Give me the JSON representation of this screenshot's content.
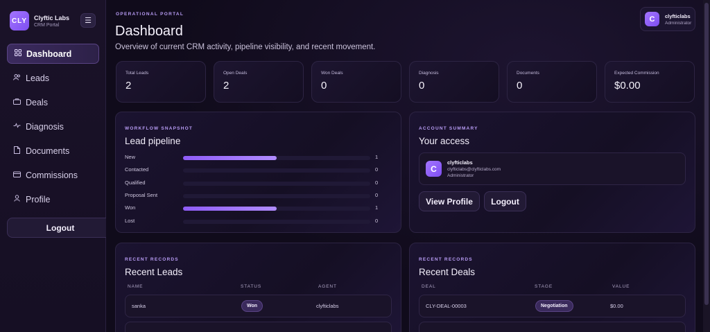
{
  "brand": {
    "logo_text": "CLY",
    "name": "Clyftic Labs",
    "subtitle": "CRM Portal"
  },
  "sidebar": {
    "toggle_icon": "hamburger-icon",
    "items": [
      {
        "label": "Dashboard",
        "icon": "grid-icon",
        "active": true
      },
      {
        "label": "Leads",
        "icon": "users-icon"
      },
      {
        "label": "Deals",
        "icon": "briefcase-icon"
      },
      {
        "label": "Diagnosis",
        "icon": "pulse-icon"
      },
      {
        "label": "Documents",
        "icon": "document-icon"
      },
      {
        "label": "Commissions",
        "icon": "wallet-icon"
      },
      {
        "label": "Profile",
        "icon": "user-icon"
      }
    ],
    "logout_label": "Logout"
  },
  "header": {
    "kicker": "OPERATIONAL PORTAL",
    "title": "Dashboard",
    "subtitle": "Overview of current CRM activity, pipeline visibility, and recent movement."
  },
  "user": {
    "initial": "C",
    "name": "clyfticlabs",
    "role": "Administrator"
  },
  "stats": [
    {
      "label": "Total Leads",
      "value": "2"
    },
    {
      "label": "Open Deals",
      "value": "2"
    },
    {
      "label": "Won Deals",
      "value": "0"
    },
    {
      "label": "Diagnosis",
      "value": "0"
    },
    {
      "label": "Documents",
      "value": "0"
    },
    {
      "label": "Expected Commission",
      "value": "$0.00"
    }
  ],
  "pipeline": {
    "kicker": "WORKFLOW SNAPSHOT",
    "title": "Lead pipeline",
    "stages": [
      {
        "label": "New",
        "count": "1",
        "fill_fraction": 0.5
      },
      {
        "label": "Contacted",
        "count": "0",
        "fill_fraction": 0
      },
      {
        "label": "Qualified",
        "count": "0",
        "fill_fraction": 0
      },
      {
        "label": "Proposal Sent",
        "count": "0",
        "fill_fraction": 0
      },
      {
        "label": "Won",
        "count": "1",
        "fill_fraction": 0.5
      },
      {
        "label": "Lost",
        "count": "0",
        "fill_fraction": 0
      }
    ]
  },
  "account": {
    "kicker": "ACCOUNT SUMMARY",
    "title": "Your access",
    "initial": "C",
    "name": "clyfticlabs",
    "email": "clyfticlabs@clyfticlabs.com",
    "role": "Administrator",
    "view_profile_label": "View Profile",
    "logout_label": "Logout"
  },
  "recent_leads": {
    "kicker": "RECENT RECORDS",
    "title": "Recent Leads",
    "columns": [
      "NAME",
      "STATUS",
      "AGENT"
    ],
    "rows": [
      {
        "name": "sanka",
        "status": "Won",
        "agent": "clyfticlabs"
      }
    ]
  },
  "recent_deals": {
    "kicker": "RECENT RECORDS",
    "title": "Recent Deals",
    "columns": [
      "DEAL",
      "STAGE",
      "VALUE"
    ],
    "rows": [
      {
        "deal": "CLY-DEAL-00003",
        "stage": "Negotiation",
        "value": "$0.00"
      }
    ]
  }
}
